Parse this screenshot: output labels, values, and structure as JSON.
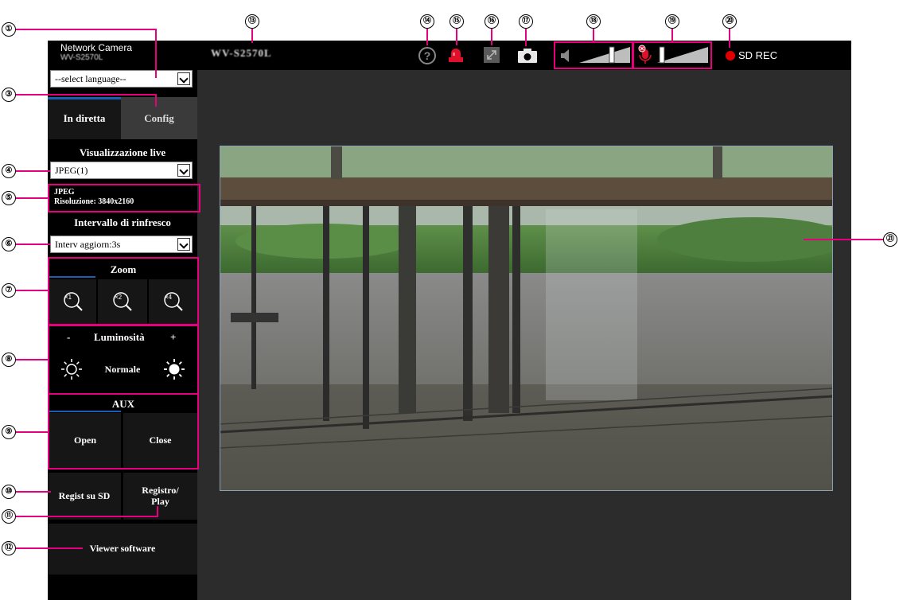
{
  "camera": {
    "label": "Network Camera",
    "model_small": "WV-S2570L",
    "model_title": "WV-S2570L"
  },
  "language_select": {
    "value": "--select language--"
  },
  "tabs": [
    {
      "label": "In diretta"
    },
    {
      "label": "Config"
    }
  ],
  "live_view": {
    "heading": "Visualizzazione live",
    "stream_select": "JPEG(1)",
    "info_line1": "JPEG",
    "info_line2": "Risoluzione: 3840x2160"
  },
  "refresh": {
    "heading": "Intervallo di rinfresco",
    "select_value": "Interv aggiorn:3s"
  },
  "zoom": {
    "heading": "Zoom",
    "buttons": [
      {
        "label": "×1"
      },
      {
        "label": "×2"
      },
      {
        "label": "×4"
      }
    ]
  },
  "brightness": {
    "minus": "-",
    "heading": "Luminosità",
    "plus": "+",
    "normal_label": "Normale"
  },
  "aux": {
    "heading": "AUX",
    "open_label": "Open",
    "close_label": "Close"
  },
  "sd_record_label": "Regist su SD",
  "record_play_label": "Registro/ Play",
  "viewer_software_label": "Viewer software",
  "toolbar": {
    "help_icon": "question-mark-icon",
    "alarm_icon": "alarm-lamp-icon",
    "fullscreen_icon": "expand-icon",
    "snapshot_icon": "camera-icon",
    "audio_output_icon": "speaker-icon",
    "audio_input_icon": "microphone-muted-icon",
    "sd_rec_label": "SD REC"
  },
  "callouts": [
    "①",
    "③",
    "④",
    "⑤",
    "⑥",
    "⑦",
    "⑧",
    "⑨",
    "⑩",
    "⑪",
    "⑫",
    "⑬",
    "⑭",
    "⑮",
    "⑯",
    "⑰",
    "⑱",
    "⑲",
    "⑳",
    "㉑"
  ],
  "colors": {
    "accent_pink": "#e6007e",
    "tab_blue": "#1a5fb4",
    "rec_red": "#e00000",
    "panel_bg": "#000000",
    "main_bg": "#2c2c2c"
  }
}
